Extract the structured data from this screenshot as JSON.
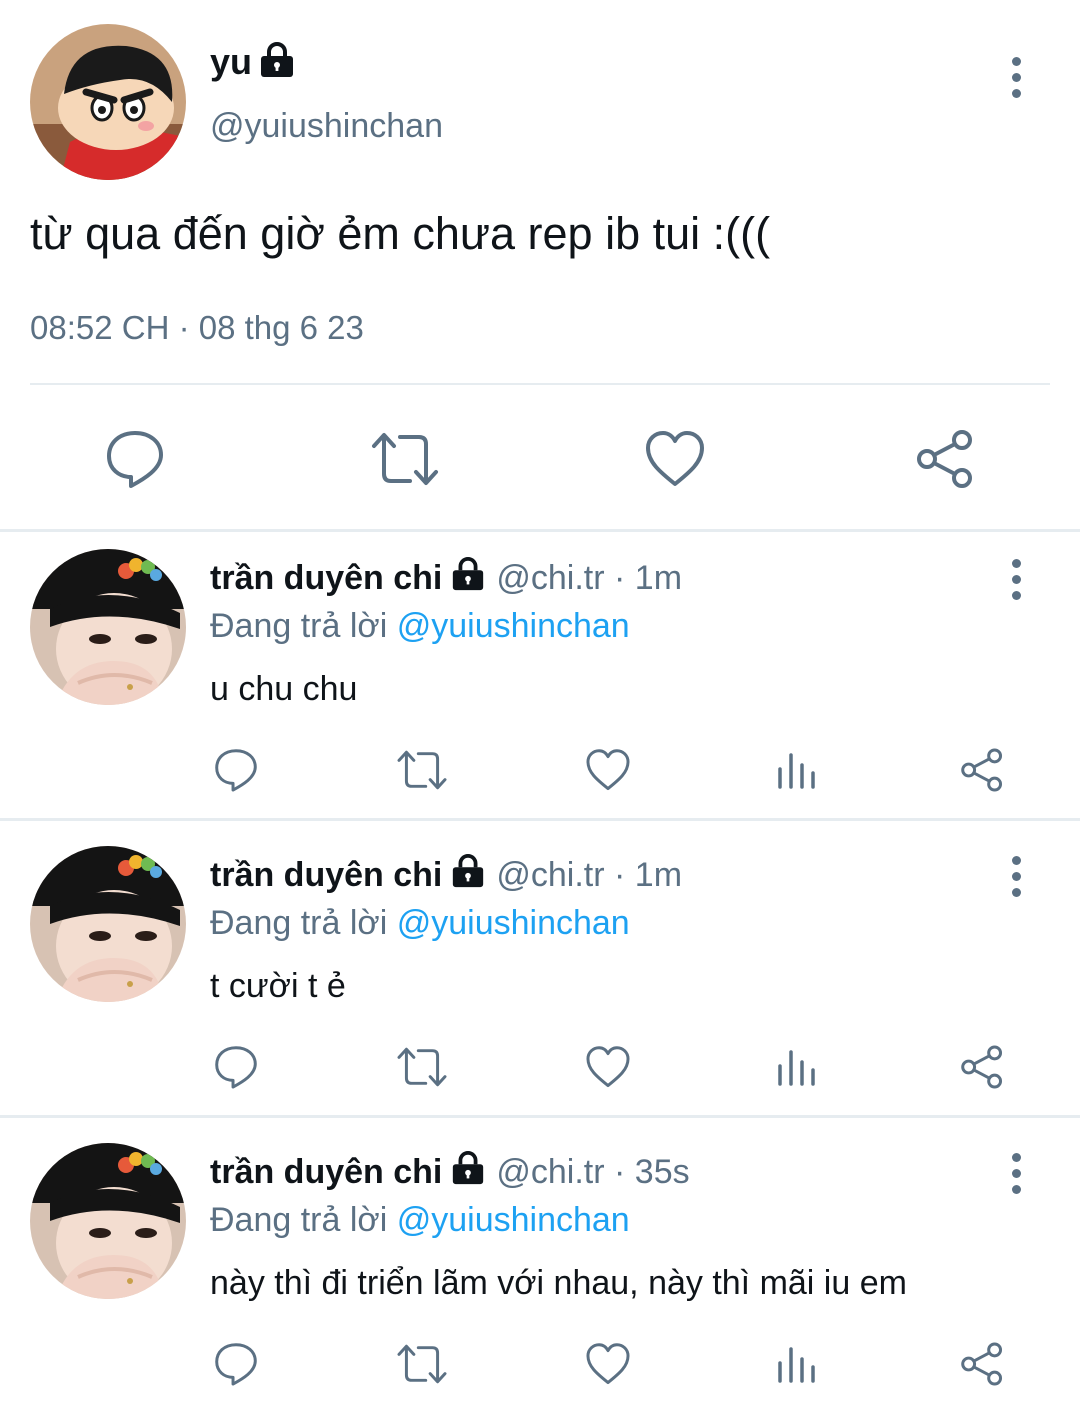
{
  "main_tweet": {
    "name": "yu",
    "handle": "@yuiushinchan",
    "text": "từ qua đến giờ ẻm chưa rep ib tui :(((",
    "timestamp": "08:52 CH · 08 thg 6 23",
    "icons": [
      "lock-icon",
      "more-icon",
      "reply-icon",
      "retweet-icon",
      "like-icon",
      "share-icon"
    ]
  },
  "replies": [
    {
      "name": "trần duyên chi",
      "handle": "@chi.tr",
      "time": "1m",
      "replying_prefix": "Đang trả lời",
      "replying_to": "@yuiushinchan",
      "text": "u chu chu"
    },
    {
      "name": "trần duyên chi",
      "handle": "@chi.tr",
      "time": "1m",
      "replying_prefix": "Đang trả lời",
      "replying_to": "@yuiushinchan",
      "text": "t cười t ẻ"
    },
    {
      "name": "trần duyên chi",
      "handle": "@chi.tr",
      "time": "35s",
      "replying_prefix": "Đang trả lời",
      "replying_to": "@yuiushinchan",
      "text": "này thì đi triển lãm với nhau, này thì mãi iu em"
    }
  ],
  "colors": {
    "text": "#0f1419",
    "secondary": "#5b7083",
    "link": "#1da1f2",
    "divider": "#e6ecf0"
  }
}
